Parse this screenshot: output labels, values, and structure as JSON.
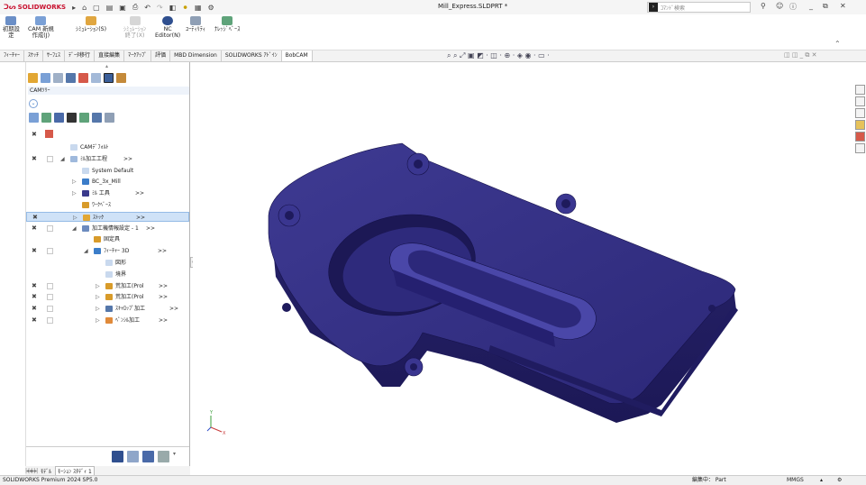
{
  "app": {
    "brand": "SOLIDWORKS",
    "document_title": "Mill_Express.SLDPRT *",
    "search_placeholder": "ｺﾏﾝﾄﾞ検索",
    "help_q": "?",
    "minimize": "_",
    "restore": "⧉",
    "close": "✕"
  },
  "command_manager": {
    "items": [
      {
        "label1": "初期設",
        "label2": "定"
      },
      {
        "label1": "CAM 新規",
        "label2": "作成(J)"
      },
      {
        "label1": "ｼﾐｭﾚｰｼｮﾝ(S)",
        "label2": ""
      },
      {
        "label1": "ｼﾐｭﾚｰｼｮﾝ",
        "label2": "終了(X)"
      },
      {
        "label1": "NC",
        "label2": "Editor(N)"
      },
      {
        "label1": "ﾕｰﾃｨﾘﾃｨ",
        "label2": ""
      },
      {
        "label1": "ﾅﾚｯｼﾞﾍﾞｰｽ",
        "label2": ""
      }
    ]
  },
  "tabs": [
    "ﾌｨｰﾁｬｰ",
    "ｽｹｯﾁ",
    "ｻｰﾌｪｽ",
    "ﾃﾞｰﾀ移行",
    "直接編集",
    "ﾏｰｸｱｯﾌﾟ",
    "評価",
    "MBD Dimension",
    "SOLIDWORKS ｱﾄﾞｲﾝ",
    "BobCAM"
  ],
  "active_tab": "BobCAM",
  "left_panel": {
    "header": "CAMﾂﾘｰ",
    "tree": [
      {
        "label": "CAMﾃﾞﾌｫﾙﾄ",
        "more": "",
        "indent": 0,
        "pin": false,
        "cb": false,
        "arrow": "",
        "ico": "#c9d9ee"
      },
      {
        "label": "ﾐﾙ加工工程",
        "more": ">>",
        "indent": 0,
        "pin": true,
        "cb": true,
        "arrow": "◢",
        "ico": "#9fb9dc"
      },
      {
        "label": "System Default",
        "more": "",
        "indent": 1,
        "pin": false,
        "cb": false,
        "arrow": "",
        "ico": "#c9d9ee"
      },
      {
        "label": "BC_3x_Mill",
        "more": "",
        "indent": 1,
        "pin": false,
        "cb": false,
        "arrow": "▷",
        "ico": "#3b7dc9"
      },
      {
        "label": "ﾐﾙ 工具",
        "more": ">>",
        "indent": 1,
        "pin": false,
        "cb": false,
        "arrow": "▷",
        "ico": "#3a3a8c"
      },
      {
        "label": "ﾜｰｸﾍﾞｰｽ",
        "more": "",
        "indent": 1,
        "pin": false,
        "cb": false,
        "arrow": "",
        "ico": "#d89b2a"
      },
      {
        "label": "ｽﾄｯｸ",
        "more": ">>",
        "indent": 1,
        "pin": true,
        "cb": false,
        "arrow": "▷",
        "ico": "#e2a734",
        "selected": true
      },
      {
        "label": "加工機情報設定 - 1",
        "more": ">>",
        "indent": 1,
        "pin": true,
        "cb": true,
        "arrow": "◢",
        "ico": "#6d8bbf"
      },
      {
        "label": "固定具",
        "more": "",
        "indent": 2,
        "pin": false,
        "cb": false,
        "arrow": "",
        "ico": "#d89b2a"
      },
      {
        "label": "ﾌｨｰﾁｬｰ 3D",
        "more": ">>",
        "indent": 2,
        "pin": true,
        "cb": true,
        "arrow": "◢",
        "ico": "#3b7dc9"
      },
      {
        "label": "図形",
        "more": "",
        "indent": 3,
        "pin": false,
        "cb": false,
        "arrow": "",
        "ico": "#c9d9ee"
      },
      {
        "label": "境界",
        "more": "",
        "indent": 3,
        "pin": false,
        "cb": false,
        "arrow": "",
        "ico": "#c9d9ee"
      },
      {
        "label": "荒加工(Prol",
        "more": ">>",
        "indent": 3,
        "pin": true,
        "cb": true,
        "arrow": "▷",
        "ico": "#d89b2a"
      },
      {
        "label": "荒加工(Prol",
        "more": ">>",
        "indent": 3,
        "pin": true,
        "cb": true,
        "arrow": "▷",
        "ico": "#d89b2a"
      },
      {
        "label": "ｽｷｬﾛｯﾌﾟ加工",
        "more": ">>",
        "indent": 3,
        "pin": true,
        "cb": true,
        "arrow": "▷",
        "ico": "#5577aa"
      },
      {
        "label": "ﾍﾟﾝｼﾙ加工",
        "more": ">>",
        "indent": 3,
        "pin": true,
        "cb": true,
        "arrow": "▷",
        "ico": "#e08a3a"
      }
    ]
  },
  "model_tabs": [
    "ﾓﾃﾞﾙ",
    "ﾓｰｼｮﾝ ｽﾀﾃﾞｨ 1"
  ],
  "status_bar": {
    "left": "SOLIDWORKS Premium 2024 SP5.0",
    "mode": "編集中： Part",
    "units": "MMGS"
  },
  "colors": {
    "part_body": "#2f2a7a",
    "part_highlight": "#4a47a8",
    "part_shadow": "#1a1650",
    "selection": "#cfe2f7"
  }
}
